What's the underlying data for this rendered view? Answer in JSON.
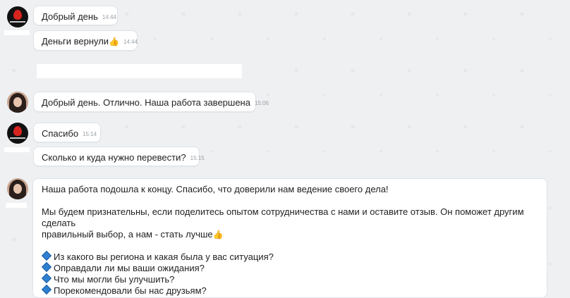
{
  "messages": [
    {
      "text": "Добрый день",
      "time": "14:44"
    },
    {
      "text": "Деньги вернули",
      "emoji": "👍",
      "time": "14:44"
    },
    {
      "text": "Добрый день. Отлично. Наша работа завершена",
      "time": "15:06"
    },
    {
      "text": "Спасибо",
      "time": "15:14"
    },
    {
      "text": "Сколько и куда нужно перевести?",
      "time": "15:15"
    }
  ],
  "long_message": {
    "line1": "Наша работа подошла к концу. Спасибо, что доверили нам ведение своего дела!",
    "line2": "Мы будем признательны, если поделитесь опытом сотрудничества с нами и оставите отзыв. Он поможет другим сделать",
    "line3": "правильный выбор, а нам - стать лучше",
    "line3_emoji": "👍",
    "q1": "Из какого вы региона и какая была у вас ситуация?",
    "q2": "Оправдали ли мы ваши ожидания?",
    "q3": "Что мы могли бы улучшить?",
    "q4": "Порекомендовали бы нас друзьям?"
  },
  "icons": {
    "bullet": "diamond-icon",
    "thumbs": "thumbs-up-icon"
  }
}
